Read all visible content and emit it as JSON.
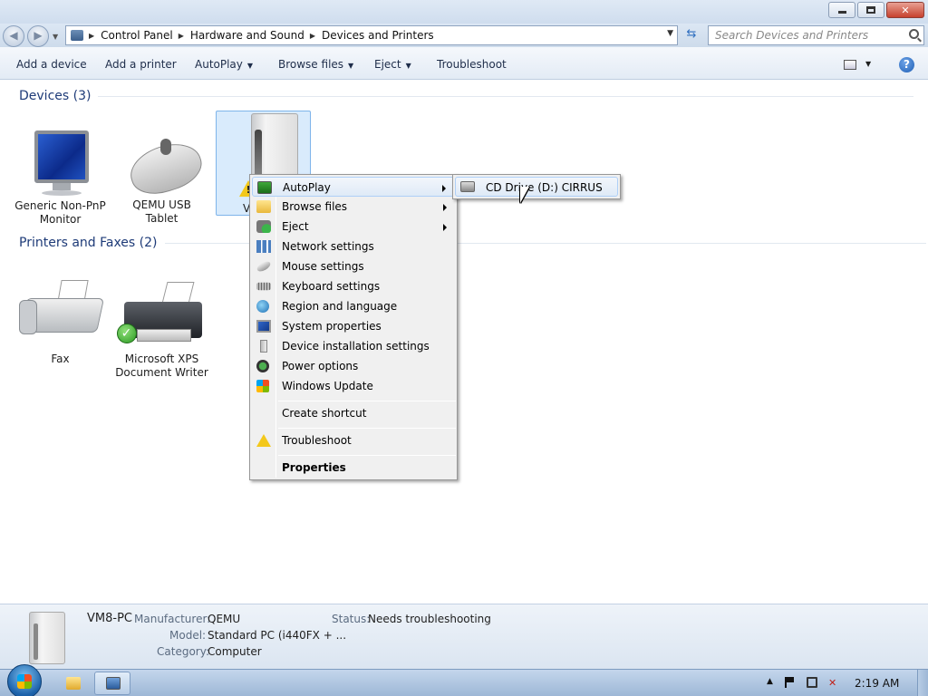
{
  "window": {
    "minimize": "–",
    "maximize": "❐",
    "close": "✕"
  },
  "address": {
    "breadcrumbs": [
      "Control Panel",
      "Hardware and Sound",
      "Devices and Printers"
    ],
    "search_placeholder": "Search Devices and Printers"
  },
  "toolbar": {
    "add_device": "Add a device",
    "add_printer": "Add a printer",
    "autoplay": "AutoPlay",
    "browse_files": "Browse files",
    "eject": "Eject",
    "troubleshoot": "Troubleshoot"
  },
  "groups": {
    "devices": "Devices (3)",
    "printers": "Printers and Faxes (2)"
  },
  "devices": [
    {
      "line1": "Generic Non-PnP",
      "line2": "Monitor",
      "icon": "monitor-icon"
    },
    {
      "line1": "QEMU USB",
      "line2": "Tablet",
      "icon": "mouse-icon"
    },
    {
      "line1": "V",
      "line2": "",
      "icon": "computer-icon",
      "status": "warning"
    }
  ],
  "printers": [
    {
      "line1": "Fax",
      "line2": "",
      "icon": "fax-icon"
    },
    {
      "line1": "Microsoft XPS",
      "line2": "Document Writer",
      "icon": "printer-icon",
      "status": "default"
    }
  ],
  "context_menu": {
    "items": [
      {
        "label": "AutoPlay",
        "icon": "autoplay-icon",
        "submenu": true
      },
      {
        "label": "Browse files",
        "icon": "folder-icon",
        "submenu": true
      },
      {
        "label": "Eject",
        "icon": "eject-icon",
        "submenu": true
      },
      {
        "label": "Network settings",
        "icon": "network-icon"
      },
      {
        "label": "Mouse settings",
        "icon": "mouse-icon"
      },
      {
        "label": "Keyboard settings",
        "icon": "keyboard-icon"
      },
      {
        "label": "Region and language",
        "icon": "globe-icon"
      },
      {
        "label": "System properties",
        "icon": "system-icon"
      },
      {
        "label": "Device installation settings",
        "icon": "computer-icon"
      },
      {
        "label": "Power options",
        "icon": "power-icon"
      },
      {
        "label": "Windows Update",
        "icon": "windows-update-icon"
      },
      {
        "label": "Create shortcut",
        "icon": ""
      },
      {
        "label": "Troubleshoot",
        "icon": "warning-icon"
      },
      {
        "label": "Properties",
        "icon": "",
        "bold": true
      }
    ],
    "submenu_item": "CD Drive (D:) CIRRUS"
  },
  "details": {
    "name": "VM8-PC",
    "manufacturer_label": "Manufacturer:",
    "manufacturer": "QEMU",
    "model_label": "Model:",
    "model": "Standard PC (i440FX + ...",
    "category_label": "Category:",
    "category": "Computer",
    "status_label": "Status:",
    "status": "Needs troubleshooting"
  },
  "taskbar": {
    "clock": "2:19 AM"
  },
  "colors": {
    "group_header": "#1e3b78",
    "selection": "#d9ebfc",
    "menu_bg": "#f0f0f0"
  }
}
